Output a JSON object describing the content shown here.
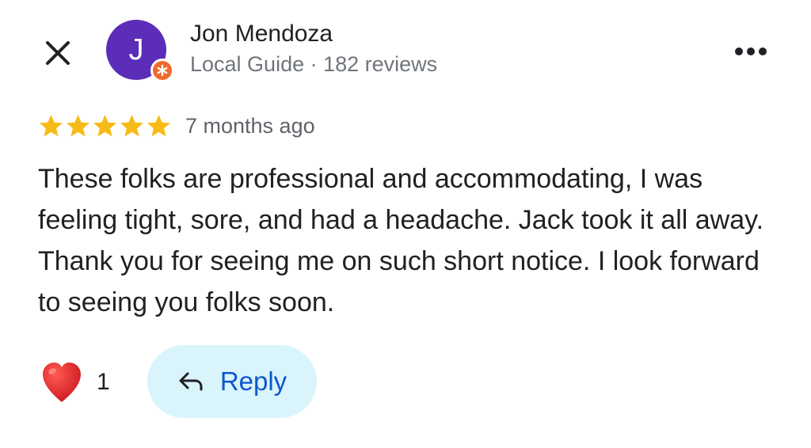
{
  "author": {
    "name": "Jon Mendoza",
    "initial": "J",
    "meta": "Local Guide · 182 reviews",
    "avatar_color": "#5b2db8",
    "badge_color": "#ee6b2c"
  },
  "review": {
    "rating": 5,
    "max_rating": 5,
    "star_color": "#f6bb16",
    "date": "7 months ago",
    "text": "These folks are professional and accommodating, I was feeling tight, sore, and had a headache. Jack took it all away. Thank you for seeing me on such short notice. I look forward to seeing you folks soon."
  },
  "actions": {
    "like_icon": "heart-icon",
    "like_count": "1",
    "reply_label": "Reply",
    "reply_icon": "reply-arrow-icon",
    "close_icon": "close-icon",
    "more_icon": "more-horizontal-icon"
  }
}
